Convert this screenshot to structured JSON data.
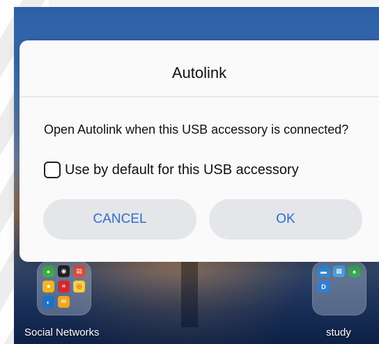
{
  "dialog": {
    "title": "Autolink",
    "message": "Open Autolink when this USB accessory is connected?",
    "checkbox_label": "Use by default for this USB accessory",
    "checkbox_checked": false,
    "cancel_label": "CANCEL",
    "ok_label": "OK",
    "accent_color": "#2a6fd6"
  },
  "home": {
    "folders": [
      {
        "label": "Social Networks"
      },
      {
        "label": "study"
      }
    ]
  }
}
